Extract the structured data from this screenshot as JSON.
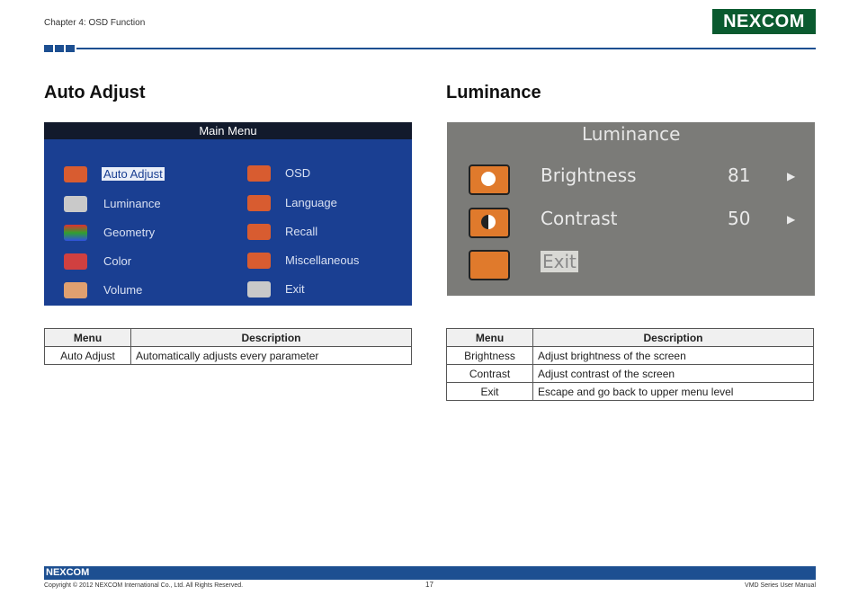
{
  "header": {
    "chapter": "Chapter 4: OSD Function",
    "logo": "NEXCOM"
  },
  "left": {
    "heading": "Auto Adjust",
    "screen": {
      "title": "Main Menu",
      "items_left": [
        "Auto Adjust",
        "Luminance",
        "Geometry",
        "Color",
        "Volume"
      ],
      "items_right": [
        "OSD",
        "Language",
        "Recall",
        "Miscellaneous",
        "Exit"
      ]
    },
    "table": {
      "headers": [
        "Menu",
        "Description"
      ],
      "rows": [
        [
          "Auto Adjust",
          "Automatically adjusts every parameter"
        ]
      ]
    }
  },
  "right": {
    "heading": "Luminance",
    "screen": {
      "title": "Luminance",
      "items": [
        {
          "label": "Brightness",
          "value": "81"
        },
        {
          "label": "Contrast",
          "value": "50"
        },
        {
          "label": "Exit",
          "value": ""
        }
      ]
    },
    "table": {
      "headers": [
        "Menu",
        "Description"
      ],
      "rows": [
        [
          "Brightness",
          "Adjust brightness of the screen"
        ],
        [
          "Contrast",
          "Adjust contrast of the screen"
        ],
        [
          "Exit",
          "Escape and go back to upper menu level"
        ]
      ]
    }
  },
  "footer": {
    "logo": "NEXCOM",
    "copyright": "Copyright © 2012 NEXCOM International Co., Ltd. All Rights Reserved.",
    "page": "17",
    "manual": "VMD Series User Manual"
  }
}
